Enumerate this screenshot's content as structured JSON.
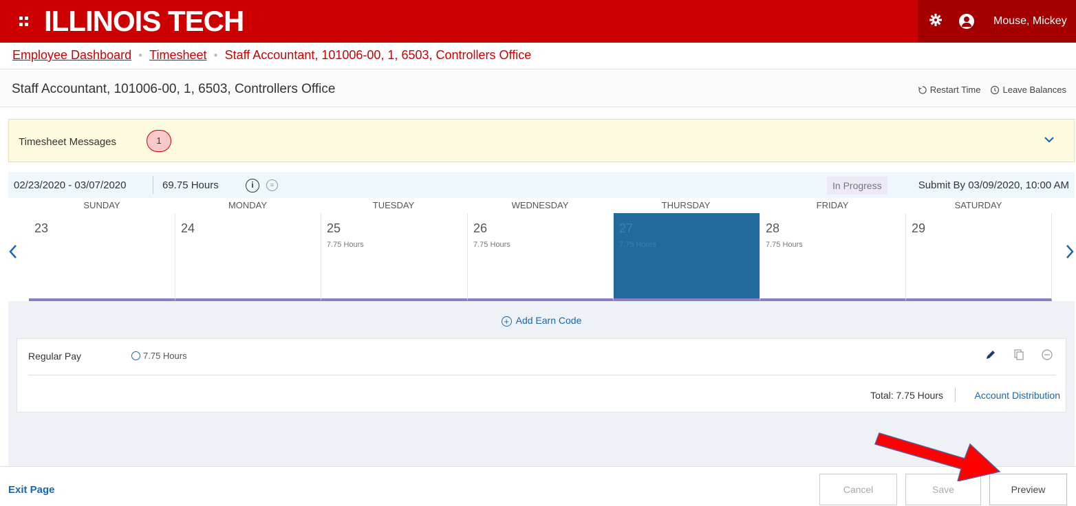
{
  "header": {
    "brand": "ILLINOIS TECH",
    "user_name": "Mouse, Mickey",
    "icons": [
      "grid-menu-icon",
      "gear-icon",
      "user-icon"
    ]
  },
  "breadcrumb": {
    "items": [
      "Employee Dashboard",
      "Timesheet",
      "Staff Accountant, 101006-00, 1, 6503, Controllers Office"
    ]
  },
  "page": {
    "title": "Staff Accountant, 101006-00, 1, 6503, Controllers Office",
    "restart_time": "Restart Time",
    "leave_balances": "Leave Balances"
  },
  "messages": {
    "label": "Timesheet Messages",
    "count": "1"
  },
  "period": {
    "range": "02/23/2020 - 03/07/2020",
    "hours": "69.75 Hours",
    "status": "In Progress",
    "submit_by": "Submit By 03/09/2020, 10:00 AM"
  },
  "days": [
    {
      "name": "SUNDAY",
      "date": "23",
      "hours": ""
    },
    {
      "name": "MONDAY",
      "date": "24",
      "hours": ""
    },
    {
      "name": "TUESDAY",
      "date": "25",
      "hours": "7.75 Hours"
    },
    {
      "name": "WEDNESDAY",
      "date": "26",
      "hours": "7.75 Hours"
    },
    {
      "name": "THURSDAY",
      "date": "27",
      "hours": "7.75 Hours",
      "selected": true
    },
    {
      "name": "FRIDAY",
      "date": "28",
      "hours": "7.75 Hours"
    },
    {
      "name": "SATURDAY",
      "date": "29",
      "hours": ""
    }
  ],
  "earn": {
    "add_label": "Add Earn Code",
    "name": "Regular Pay",
    "hours": "7.75 Hours",
    "total": "Total: 7.75 Hours",
    "account_distribution": "Account Distribution"
  },
  "footer": {
    "exit": "Exit Page",
    "cancel": "Cancel",
    "save": "Save",
    "preview": "Preview"
  },
  "colors": {
    "brand_red": "#cc0000",
    "selected_day": "#236a9c",
    "link_blue": "#1a66b0",
    "annotation_arrow": "#ff0000"
  }
}
